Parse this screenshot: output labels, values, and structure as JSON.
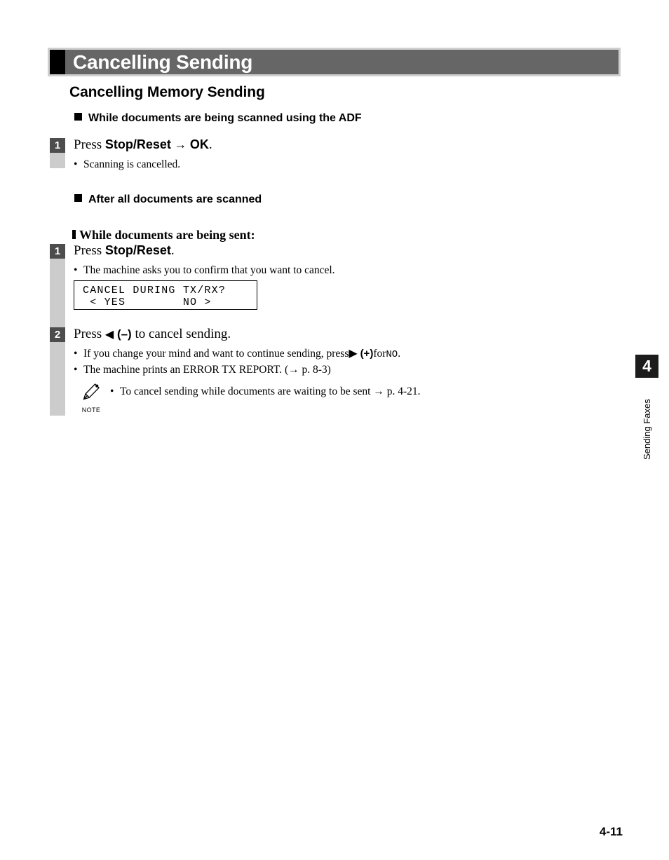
{
  "banner": {
    "title": "Cancelling Sending",
    "bg_color": "#666666",
    "border_color": "#cfcfcf",
    "square_color": "#000000"
  },
  "section": {
    "heading": "Cancelling Memory Sending"
  },
  "subheads": {
    "adf": "While documents are being scanned using the ADF",
    "after_scanned": "After all documents are scanned",
    "being_sent": "While documents are being sent:"
  },
  "steps": [
    {
      "number": "1",
      "text_prefix": "Press ",
      "key1": "Stop/Reset",
      "arrow": " → ",
      "key2": "OK",
      "text_suffix": ".",
      "bullets": [
        {
          "text": "Scanning is cancelled."
        }
      ]
    },
    {
      "number": "1",
      "text_prefix": "Press ",
      "key1": "Stop/Reset",
      "text_suffix": ".",
      "bullets": [
        {
          "text": "The machine asks you to confirm that you want to cancel."
        }
      ]
    },
    {
      "number": "2",
      "text_prefix": "Press ",
      "triangle": "◀",
      "sign": "(–)",
      "text_suffix": " to cancel sending.",
      "bullets": [
        {
          "part1": "If you change your mind and want to continue sending, press ",
          "triangle": "▶",
          "sign": "(+)",
          "part2": " for ",
          "mono": "NO",
          "part3": "."
        },
        {
          "text": "The machine prints an ERROR TX REPORT. (→ p. 8-3)"
        }
      ]
    }
  ],
  "lcd": {
    "line1": "CANCEL DURING TX/RX?",
    "line2": " < YES        NO >"
  },
  "note": {
    "icon": "pencil-icon",
    "label": "NOTE",
    "bullet": "•",
    "text": "To cancel sending while documents are waiting to be sent → p. 4-21."
  },
  "chapter_tab": {
    "number": "4",
    "label": "Sending Faxes",
    "bg_color": "#1c1c1c"
  },
  "footer": {
    "page_number": "4-11"
  }
}
